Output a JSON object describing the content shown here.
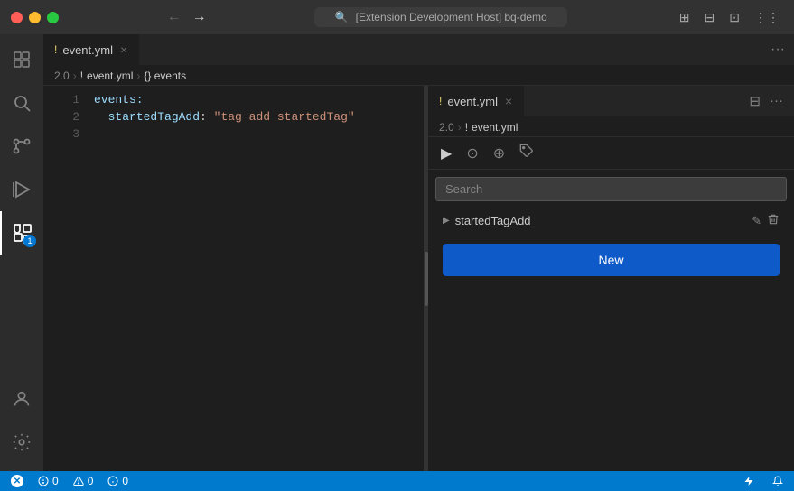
{
  "titleBar": {
    "title": "[Extension Development Host] bq-demo",
    "searchIcon": "🔍",
    "backArrow": "←",
    "forwardArrow": "→"
  },
  "activityBar": {
    "items": [
      {
        "name": "explorer",
        "icon": "⧉",
        "active": false
      },
      {
        "name": "search",
        "icon": "🔍",
        "active": false
      },
      {
        "name": "source-control",
        "icon": "⑂",
        "active": false
      },
      {
        "name": "run",
        "icon": "▷",
        "active": false
      },
      {
        "name": "extensions",
        "icon": "⊞",
        "active": true,
        "badge": "1"
      }
    ],
    "bottomItems": [
      {
        "name": "accounts",
        "icon": "👤",
        "active": false
      },
      {
        "name": "settings",
        "icon": "⚙",
        "active": false
      }
    ]
  },
  "leftEditor": {
    "tab": {
      "icon": "!",
      "label": "event.yml",
      "closeBtn": "×"
    },
    "moreBtn": "···",
    "breadcrumb": {
      "version": "2.0",
      "file": "event.yml",
      "path": "{} events"
    },
    "code": {
      "lines": [
        {
          "num": "1",
          "content": "events:",
          "type": "key"
        },
        {
          "num": "2",
          "content": "  startedTagAdd: \"tag add startedTag\"",
          "type": "value"
        },
        {
          "num": "3",
          "content": "",
          "type": "empty"
        }
      ]
    }
  },
  "rightPanel": {
    "tab": {
      "icon": "!",
      "label": "event.yml",
      "closeBtn": "×"
    },
    "breadcrumb": {
      "version": "2.0",
      "file": "event.yml"
    },
    "toolbar": {
      "playBtn": "▶",
      "circleBtn": "⊙",
      "zoomBtn": "⊕",
      "tagBtn": "🏷"
    },
    "search": {
      "placeholder": "Search",
      "value": ""
    },
    "events": [
      {
        "name": "startedTagAdd",
        "editIcon": "✎",
        "deleteIcon": "🗑"
      }
    ],
    "newButton": "New",
    "moreBtn": "···",
    "splitBtn": "⊟"
  },
  "statusBar": {
    "xIcon": "✕",
    "errors": "0",
    "warnings": "0",
    "info": "0",
    "rightItems": [
      "⚡",
      "🔔"
    ]
  }
}
